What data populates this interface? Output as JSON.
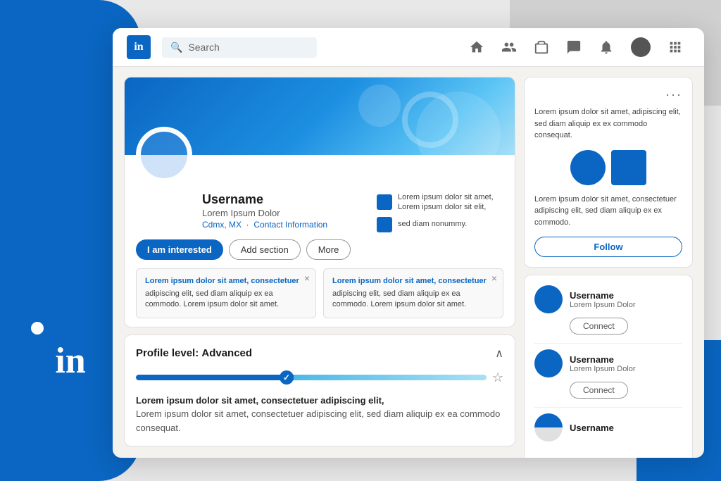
{
  "app": {
    "title": "LinkedIn",
    "logo_text": "in"
  },
  "navbar": {
    "search_placeholder": "Search",
    "icons": [
      "home",
      "people",
      "briefcase",
      "chat",
      "bell",
      "avatar",
      "grid"
    ]
  },
  "profile": {
    "name": "Username",
    "title": "Lorem Ipsum Dolor",
    "location": "Cdmx, MX",
    "contact_link": "Contact Information",
    "btn_interested": "I am interested",
    "btn_add_section": "Add section",
    "btn_more": "More",
    "card1": {
      "text1": "Lorem ipsum dolor sit amet,",
      "text2": "Lorem ipsum dolor sit elit,"
    },
    "card2": {
      "text1": "sed diam nonummy."
    }
  },
  "activity_cards": [
    {
      "title": "Lorem ipsum dolor sit amet, consectetuer",
      "body": "adipiscing elit, sed diam aliquip ex ea commodo.\nLorem ipsum dolor sit amet."
    },
    {
      "title": "Lorem ipsum dolor sit amet, consectetuer",
      "body": "adipiscing elit, sed diam aliquip ex ea commodo.\nLorem ipsum dolor sit amet."
    }
  ],
  "profile_level": {
    "label": "Profile level:",
    "level": "Advanced",
    "progress_pct": 55,
    "description": "Lorem ipsum dolor sit amet, consectetuer adipiscing elit,\nsed diam aliquip ex ea commodo consequat."
  },
  "sponsored": {
    "text": "Lorem ipsum dolor sit amet, adipiscing elit, sed diam aliquip ex ex commodo consequat.",
    "desc": "Lorem ipsum dolor sit amet, consectetuer adipiscing elit, sed diam aliquip ex ex commodo.",
    "btn_follow": "Follow"
  },
  "people": [
    {
      "name": "Username",
      "title": "Lorem Ipsum Dolor",
      "btn": "Connect"
    },
    {
      "name": "Username",
      "title": "Lorem Ipsum Dolor",
      "btn": "Connect"
    },
    {
      "name": "Username",
      "title": "",
      "btn": ""
    }
  ],
  "colors": {
    "brand_blue": "#0a66c2",
    "light_blue": "#4db8e8",
    "bg_gray": "#f3f2ef"
  }
}
